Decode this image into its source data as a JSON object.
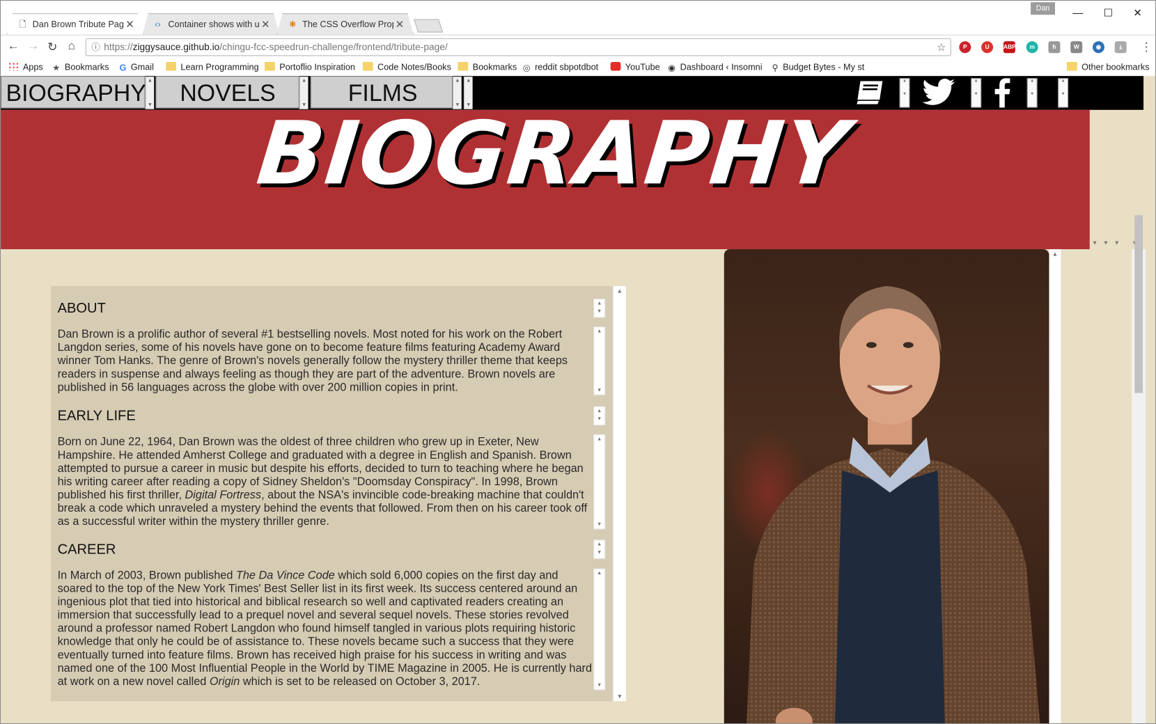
{
  "browser": {
    "user_badge": "Dan",
    "tabs": [
      {
        "title": "Dan Brown Tribute Page",
        "icon": "page-icon"
      },
      {
        "title": "Container shows with unwanted scrollbars",
        "icon": "code-icon"
      },
      {
        "title": "The CSS Overflow Property",
        "icon": "asterisk-icon"
      }
    ],
    "url_prefix": "https://",
    "url_domain": "ziggysauce.github.io",
    "url_path": "/chingu-fcc-speedrun-challenge/frontend/tribute-page/",
    "bookmarks": [
      {
        "label": "Apps",
        "icon": "apps-icon"
      },
      {
        "label": "Bookmarks",
        "icon": "star-icon"
      },
      {
        "label": "Gmail",
        "icon": "google-icon"
      },
      {
        "label": "Learn Programming",
        "icon": "folder-icon"
      },
      {
        "label": "Portoflio Inspiration",
        "icon": "folder-icon"
      },
      {
        "label": "Code Notes/Books",
        "icon": "folder-icon"
      },
      {
        "label": "Bookmarks",
        "icon": "folder-icon"
      },
      {
        "label": "reddit sbpotdbot",
        "icon": "reddit-icon"
      },
      {
        "label": "YouTube",
        "icon": "youtube-icon"
      },
      {
        "label": "Dashboard ‹ Insomni",
        "icon": "eye-icon"
      },
      {
        "label": "Budget Bytes - My st",
        "icon": "search-icon"
      }
    ],
    "other_bookmarks": "Other bookmarks"
  },
  "site": {
    "nav": [
      "BIOGRAPHY",
      "NOVELS",
      "FILMS"
    ],
    "social_icons": [
      "book-icon",
      "twitter-icon",
      "facebook-icon"
    ],
    "hero_title": "BIOGRAPHY",
    "sections": [
      {
        "heading": "ABOUT",
        "body": "Dan Brown is a prolific author of several #1 bestselling novels. Most noted for his work on the Robert Langdon series, some of his novels have gone on to become feature films featuring Academy Award winner Tom Hanks. The genre of Brown's novels generally follow the mystery thriller theme that keeps readers in suspense and always feeling as though they are part of the adventure. Brown novels are published in 56 languages across the globe with over 200 million copies in print."
      },
      {
        "heading": "EARLY LIFE",
        "body_parts": [
          "Born on June 22, 1964, Dan Brown was the oldest of three children who grew up in Exeter, New Hampshire. He attended Amherst College and graduated with a degree in English and Spanish. Brown attempted to pursue a career in music but despite his efforts, decided to turn to teaching where he began his writing career after reading a copy of Sidney Sheldon's \"Doomsday Conspiracy\". In 1998, Brown published his first thriller, ",
          "Digital Fortress",
          ", about the NSA's invincible code-breaking machine that couldn't break a code which unraveled a mystery behind the events that followed. From then on his career took off as a successful writer within the mystery thriller genre."
        ]
      },
      {
        "heading": "CAREER",
        "body_parts": [
          "In March of 2003, Brown published ",
          "The Da Vince Code",
          " which sold 6,000 copies on the first day and soared to the top of the New York Times' Best Seller list in its first week. Its success centered around an ingenious plot that tied into historical and biblical research so well and captivated readers creating an immersion that successfully lead to a prequel novel and several sequel novels. These stories revolved around a professor named Robert Langdon who found himself tangled in various plots requiring historic knowledge that only he could be of assistance to. These novels became such a success that they were eventually turned into feature films. Brown has received high praise for his success in writing and was named one of the 100 Most Influential People in the World by TIME Magazine in 2005. He is currently hard at work on a new novel called ",
          "Origin",
          " which is set to be released on October 3, 2017."
        ]
      }
    ]
  },
  "colors": {
    "hero": "#b03134",
    "page_bg": "#e8dfc5",
    "text_box": "#d6cbb3",
    "nav_bar": "#000000"
  }
}
